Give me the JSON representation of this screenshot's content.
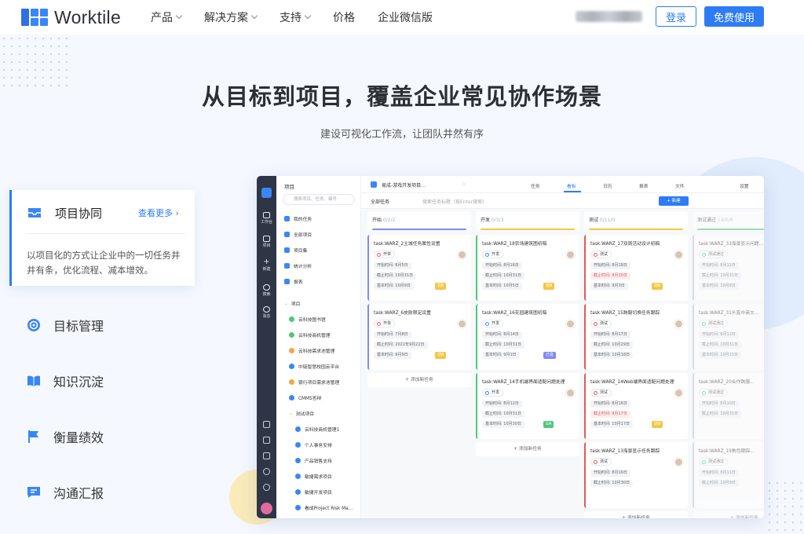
{
  "header": {
    "brand": "Worktile",
    "nav": [
      {
        "label": "产品",
        "dropdown": true
      },
      {
        "label": "解决方案",
        "dropdown": true
      },
      {
        "label": "支持",
        "dropdown": true
      },
      {
        "label": "价格",
        "dropdown": false
      },
      {
        "label": "企业微信版",
        "dropdown": false
      }
    ],
    "login": "登录",
    "free_trial": "免费使用"
  },
  "hero": {
    "title": "从目标到项目，覆盖企业常见协作场景",
    "subtitle": "建设可视化工作流，让团队井然有序"
  },
  "features": {
    "active": {
      "title": "项目协同",
      "more": "查看更多 ›",
      "desc": "以项目化的方式让企业中的一切任务井井有条，优化流程、减本增效。"
    },
    "items": [
      {
        "label": "目标管理",
        "icon": "target-icon"
      },
      {
        "label": "知识沉淀",
        "icon": "book-icon"
      },
      {
        "label": "衡量绩效",
        "icon": "flag-icon"
      },
      {
        "label": "沟通汇报",
        "icon": "chat-icon"
      }
    ]
  },
  "app": {
    "rail": [
      "工作台",
      "项目",
      "新建",
      "搜索",
      "消息"
    ],
    "sidebar": {
      "title": "项目",
      "search_placeholder": "搜索项目、任务、编号",
      "top_items": [
        "我的任务",
        "全部项目",
        "项目集",
        "统计分析",
        "报表"
      ],
      "section": "项目",
      "projects": [
        "云科技图书馆",
        "云科技商机管理",
        "云科技需求池管理",
        "中链智慧校园云平台",
        "银行项目需求池管理",
        "CMMS答辩"
      ],
      "group": "测试项目",
      "group_projects": [
        "云科技商机管理1",
        "个人事务安排",
        "产品销售支持",
        "敏捷需求项目",
        "敏捷开发项目",
        "看成Project Risk Ma..."
      ]
    },
    "topbar": {
      "project": "易成-游戏开发项目...",
      "tabs": [
        "任务",
        "看板",
        "日历",
        "报表",
        "文件"
      ],
      "active_tab": "看板",
      "settings": "设置",
      "filter": "全部任务",
      "search_placeholder": "搜索任务标题（按Enter搜索）",
      "new": "+ 新建"
    },
    "columns": [
      {
        "title": "开始",
        "count": "0/2/2",
        "color": "#7c8bf5",
        "cards": [
          {
            "title": "task:WARZ_2主城任务属性设置",
            "status": "开单",
            "start": "开始时间: 8月5日",
            "due": "截止时间: 10月31日",
            "est": "基本时间: 10月9日",
            "tag": "前B"
          },
          {
            "title": "task:WARZ_6皮肤限定设置",
            "status": "开单",
            "start": "开始时间: 7月8日",
            "due": "截止时间: 2022年9月22日",
            "est": "基本时间: 9月9日",
            "tag": "前B"
          }
        ],
        "add": "添加新任务"
      },
      {
        "title": "开发",
        "count": "0/3/3",
        "color": "#f5c542",
        "cards": [
          {
            "title": "task:WARZ_18农场建筑图初稿",
            "status": "开发",
            "start": "开始时间: 8月16日",
            "due": "截止时间: 10月31日",
            "est": "基本时间: 10月5日",
            "tag": "前B"
          },
          {
            "title": "task:WARZ_16花园建筑图初稿",
            "status": "开发",
            "start": "开始时间: 8月14日",
            "due": "截止时间: 10月31日",
            "est": "基本时间: 9月1日",
            "tag": "已批"
          },
          {
            "title": "task:WARZ_14手机端界面适配问题处理",
            "status": "开发",
            "start": "开始时间: 8月12日",
            "due": "截止时间: 10月31日",
            "est": "基本时间: 10月30日",
            "tag": "GA"
          }
        ],
        "add": "添加新任务"
      },
      {
        "title": "测试",
        "count": "0/11/0",
        "color": "#f5c542",
        "cards": [
          {
            "title": "task:WARZ_17双周活动设计初稿",
            "status": "测试",
            "start": "开始时间: 8月18日",
            "due": "截止时间: 9月30日",
            "est": "基本时间: 9月3日",
            "tag": "前B"
          },
          {
            "title": "task:WARZ_15跨服切换任务跟踪",
            "status": "测试",
            "start": "开始时间: 8月17日",
            "due": "截止时间: 10月29日",
            "est": "基本时间: 10月18日",
            "tag": ""
          },
          {
            "title": "task:WARZ_14Web端界面适配问题处理",
            "status": "测试",
            "start": "开始时间: 8月16日",
            "due": "截止时间: 9月17日",
            "est": "基本时间: 10月17日",
            "tag": "前B"
          },
          {
            "title": "task:WARZ_13海景显示任务跟踪",
            "status": "测试",
            "start": "开始时间: 8月16日",
            "due": "截止时间: 10月30日",
            "est": "",
            "tag": ""
          }
        ],
        "add": "添加新任务"
      },
      {
        "title": "测试通过",
        "count": "14/0/8",
        "color": "#52c77a",
        "cards": [
          {
            "title": "task:WARZ_33海景显示问题...",
            "status": "测试通过",
            "start": "开始时间: 8月12日",
            "due": "截止时间: 10月31日",
            "est": "基本时间: 10月9日",
            "tag": ""
          },
          {
            "title": "task:WARZ_31头盔中英文...",
            "status": "测试通过",
            "start": "开始时间: 8月12日",
            "due": "截止时间: 10月31日",
            "est": "基本时间: 10月15日",
            "tag": ""
          },
          {
            "title": "task:WARZ_20合作跨服...",
            "status": "测试通过",
            "start": "开始时间: 8月10日",
            "due": "截止时间: 10月31日",
            "est": "",
            "tag": ""
          },
          {
            "title": "task:WARZ_19角色跟踪...",
            "status": "测试通过",
            "start": "开始时间: 8月11日",
            "due": "截止时间: 10月9日",
            "est": "",
            "tag": ""
          }
        ],
        "add": "添加新任务"
      }
    ]
  },
  "colors": {
    "primary": "#2d7cf6",
    "rail": "#2e3547",
    "background": "#f5f8fe"
  }
}
